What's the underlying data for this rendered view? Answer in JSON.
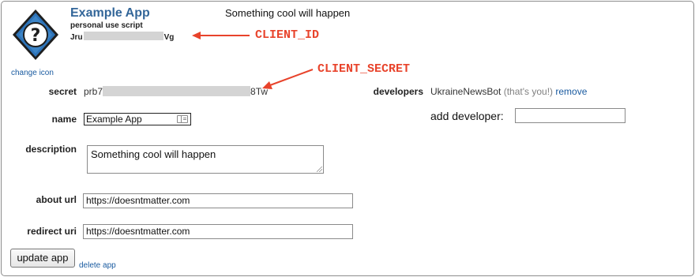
{
  "app": {
    "title": "Example App",
    "type": "personal use script",
    "client_id_start": "Jru",
    "client_id_end": "Vg",
    "description_heading": "Something cool will happen",
    "change_icon_label": "change icon"
  },
  "annotations": {
    "client_id": "CLIENT_ID",
    "client_secret": "CLIENT_SECRET",
    "color": "#e8432b"
  },
  "form": {
    "secret_label": "secret",
    "secret_start": "prb7",
    "secret_end": "8Tw",
    "name_label": "name",
    "name_value": "Example App",
    "description_label": "description",
    "description_value": "Something cool will happen",
    "about_label": "about url",
    "about_value": "https://doesntmatter.com",
    "redirect_label": "redirect uri",
    "redirect_value": "https://doesntmatter.com",
    "update_button": "update app",
    "delete_link": "delete app"
  },
  "developers": {
    "label": "developers",
    "name": "UkraineNewsBot",
    "note": "(that's you!)",
    "remove_label": "remove",
    "add_label": "add developer:",
    "add_value": ""
  },
  "colors": {
    "title": "#336699",
    "link": "#1a5ba0",
    "icon_blue": "#2d73b8"
  }
}
